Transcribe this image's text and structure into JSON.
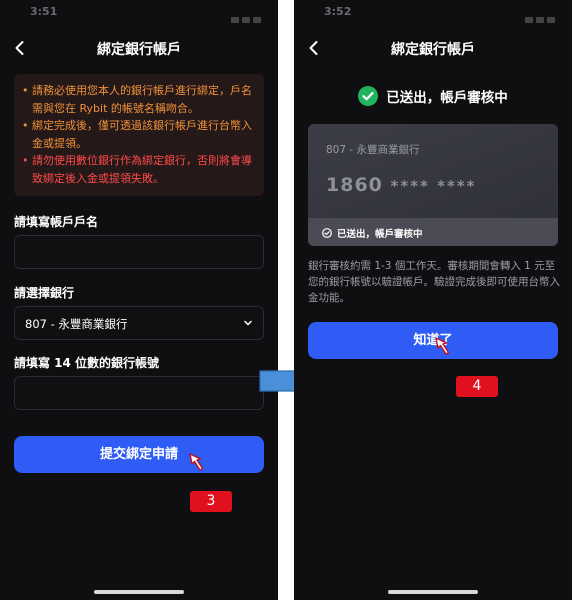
{
  "colors": {
    "background": "#0f0f11",
    "primary": "#2f5cf5",
    "warning_orange": "#f0923a",
    "warning_red": "#ff4a4a",
    "success_green": "#22b35e",
    "step_badge": "#e0101e",
    "flow_arrow": "#4a90d9"
  },
  "left_screen": {
    "status_time": "3:51",
    "title": "綁定銀行帳戶",
    "notice": [
      {
        "text": "請務必使用您本人的銀行帳戶進行綁定，戶名需與您在 Rybit 的帳號名稱吻合。",
        "tone": "orange"
      },
      {
        "text": "綁定完成後，僅可透過該銀行帳戶進行台幣入金或提領。",
        "tone": "orange"
      },
      {
        "text": "請勿使用數位銀行作為綁定銀行，否則將會導致綁定後入金或提領失敗。",
        "tone": "red"
      }
    ],
    "account_name": {
      "label": "請填寫帳戶戶名",
      "value": "",
      "placeholder": ""
    },
    "bank_select": {
      "label": "請選擇銀行",
      "selected": "807 - 永豐商業銀行",
      "icon": "chevron-down-icon"
    },
    "account_number": {
      "label": "請填寫 14 位數的銀行帳號",
      "value": "",
      "placeholder": ""
    },
    "submit_label": "提交綁定申請",
    "step_badge": "3"
  },
  "right_screen": {
    "status_time": "3:52",
    "title": "綁定銀行帳戶",
    "success_text": "已送出，帳戶審核中",
    "card": {
      "bank_name": "807 - 永豐商業銀行",
      "number_prefix": "1860",
      "number_mask": "**** ****",
      "status": "已送出，帳戶審核中"
    },
    "review_note": "銀行審核約需 1-3 個工作天。審核期間會轉入 1 元至您的銀行帳號以驗證帳戶。驗證完成後即可使用台幣入金功能。",
    "confirm_label": "知道了",
    "step_badge": "4"
  }
}
